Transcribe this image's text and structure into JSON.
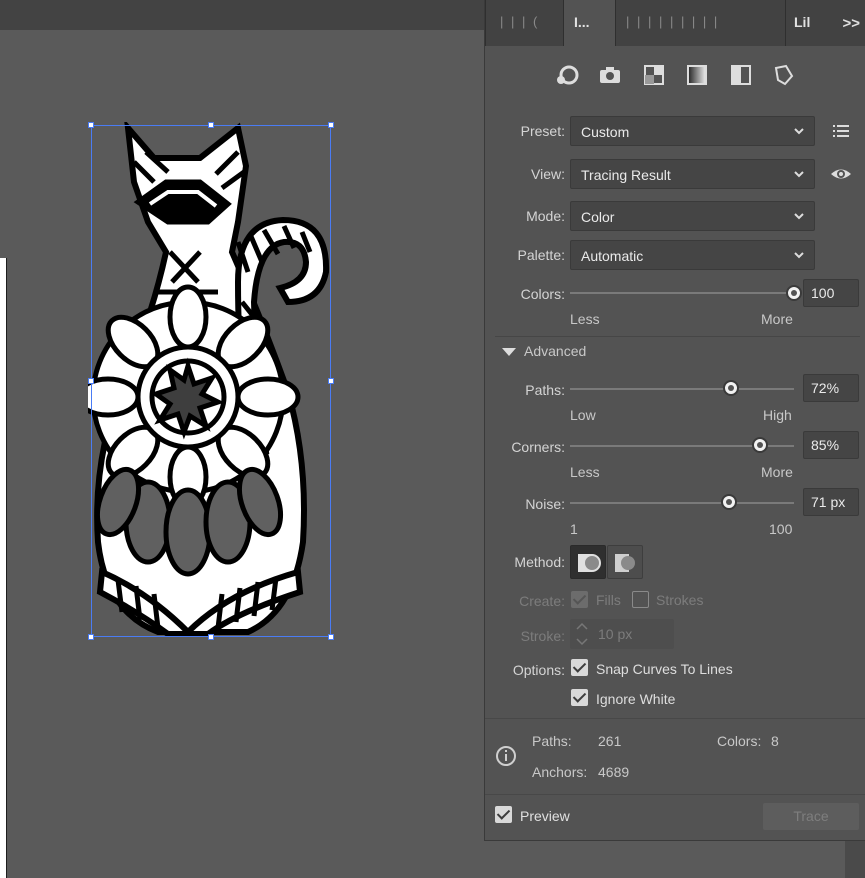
{
  "panel": {
    "active_tab_label": "I...",
    "right_tab_label": "Lil",
    "overflow_label": ">>",
    "preset": {
      "label": "Preset:",
      "value": "Custom"
    },
    "view": {
      "label": "View:",
      "value": "Tracing Result"
    },
    "mode": {
      "label": "Mode:",
      "value": "Color"
    },
    "palette": {
      "label": "Palette:",
      "value": "Automatic"
    },
    "colors": {
      "label": "Colors:",
      "value": "100",
      "min_label": "Less",
      "max_label": "More",
      "level": 1.0
    },
    "advanced_label": "Advanced",
    "paths": {
      "label": "Paths:",
      "value": "72%",
      "min_label": "Low",
      "max_label": "High",
      "level": 0.72
    },
    "corners": {
      "label": "Corners:",
      "value": "85%",
      "min_label": "Less",
      "max_label": "More",
      "level": 0.85
    },
    "noise": {
      "label": "Noise:",
      "value": "71 px",
      "min_label": "1",
      "max_label": "100",
      "level": 0.71
    },
    "method_label": "Method:",
    "create": {
      "label": "Create:",
      "fills_label": "Fills",
      "strokes_label": "Strokes"
    },
    "stroke": {
      "label": "Stroke:",
      "value": "10 px"
    },
    "options": {
      "label": "Options:",
      "snap_label": "Snap Curves To Lines",
      "ignore_white_label": "Ignore White"
    },
    "stats": {
      "paths_label": "Paths:",
      "paths_value": "261",
      "colors_label": "Colors:",
      "colors_value": "8",
      "anchors_label": "Anchors:",
      "anchors_value": "4689"
    },
    "preview_label": "Preview",
    "trace_label": "Trace"
  },
  "icons": [
    "auto-color-icon",
    "camera-icon",
    "grayscale-grid-icon",
    "gradient-icon",
    "half-fill-icon",
    "outline-shape-icon",
    "list-menu-icon",
    "eye-icon",
    "info-icon"
  ]
}
